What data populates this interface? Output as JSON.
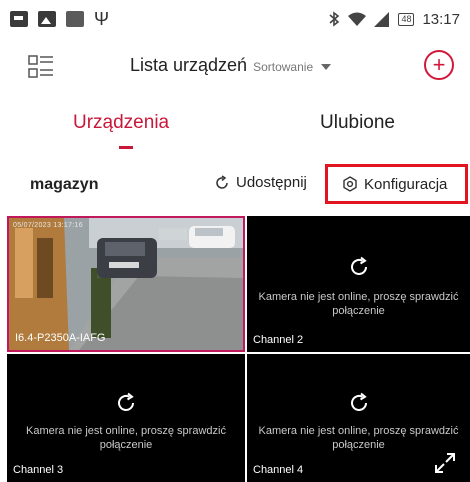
{
  "status_bar": {
    "time": "13:17",
    "battery": "48",
    "icons": [
      "message-icon",
      "gallery-icon",
      "square-icon",
      "usb-icon",
      "bluetooth-icon",
      "wifi-icon",
      "signal-icon",
      "battery-icon"
    ]
  },
  "header": {
    "title": "Lista urządzeń",
    "sort_label": "Sortowanie",
    "add_symbol": "+"
  },
  "tabs": [
    {
      "label": "Urządzenia",
      "active": true
    },
    {
      "label": "Ulubione",
      "active": false
    }
  ],
  "group": {
    "name": "magazyn",
    "share_label": "Udostępnij",
    "config_label": "Konfiguracja"
  },
  "cameras": [
    {
      "label": "I6.4-P2350A-IAFG",
      "online": true,
      "timestamp": "05/07/2023 13:17:16"
    },
    {
      "label": "Channel 2",
      "online": false
    },
    {
      "label": "Channel 3",
      "online": false
    },
    {
      "label": "Channel 4",
      "online": false
    }
  ],
  "offline_message": {
    "line1": "Kamera nie jest online, proszę sprawdzić",
    "line2": "połączenie"
  },
  "colors": {
    "accent": "#c8183a",
    "highlight_box": "#e0151f"
  }
}
